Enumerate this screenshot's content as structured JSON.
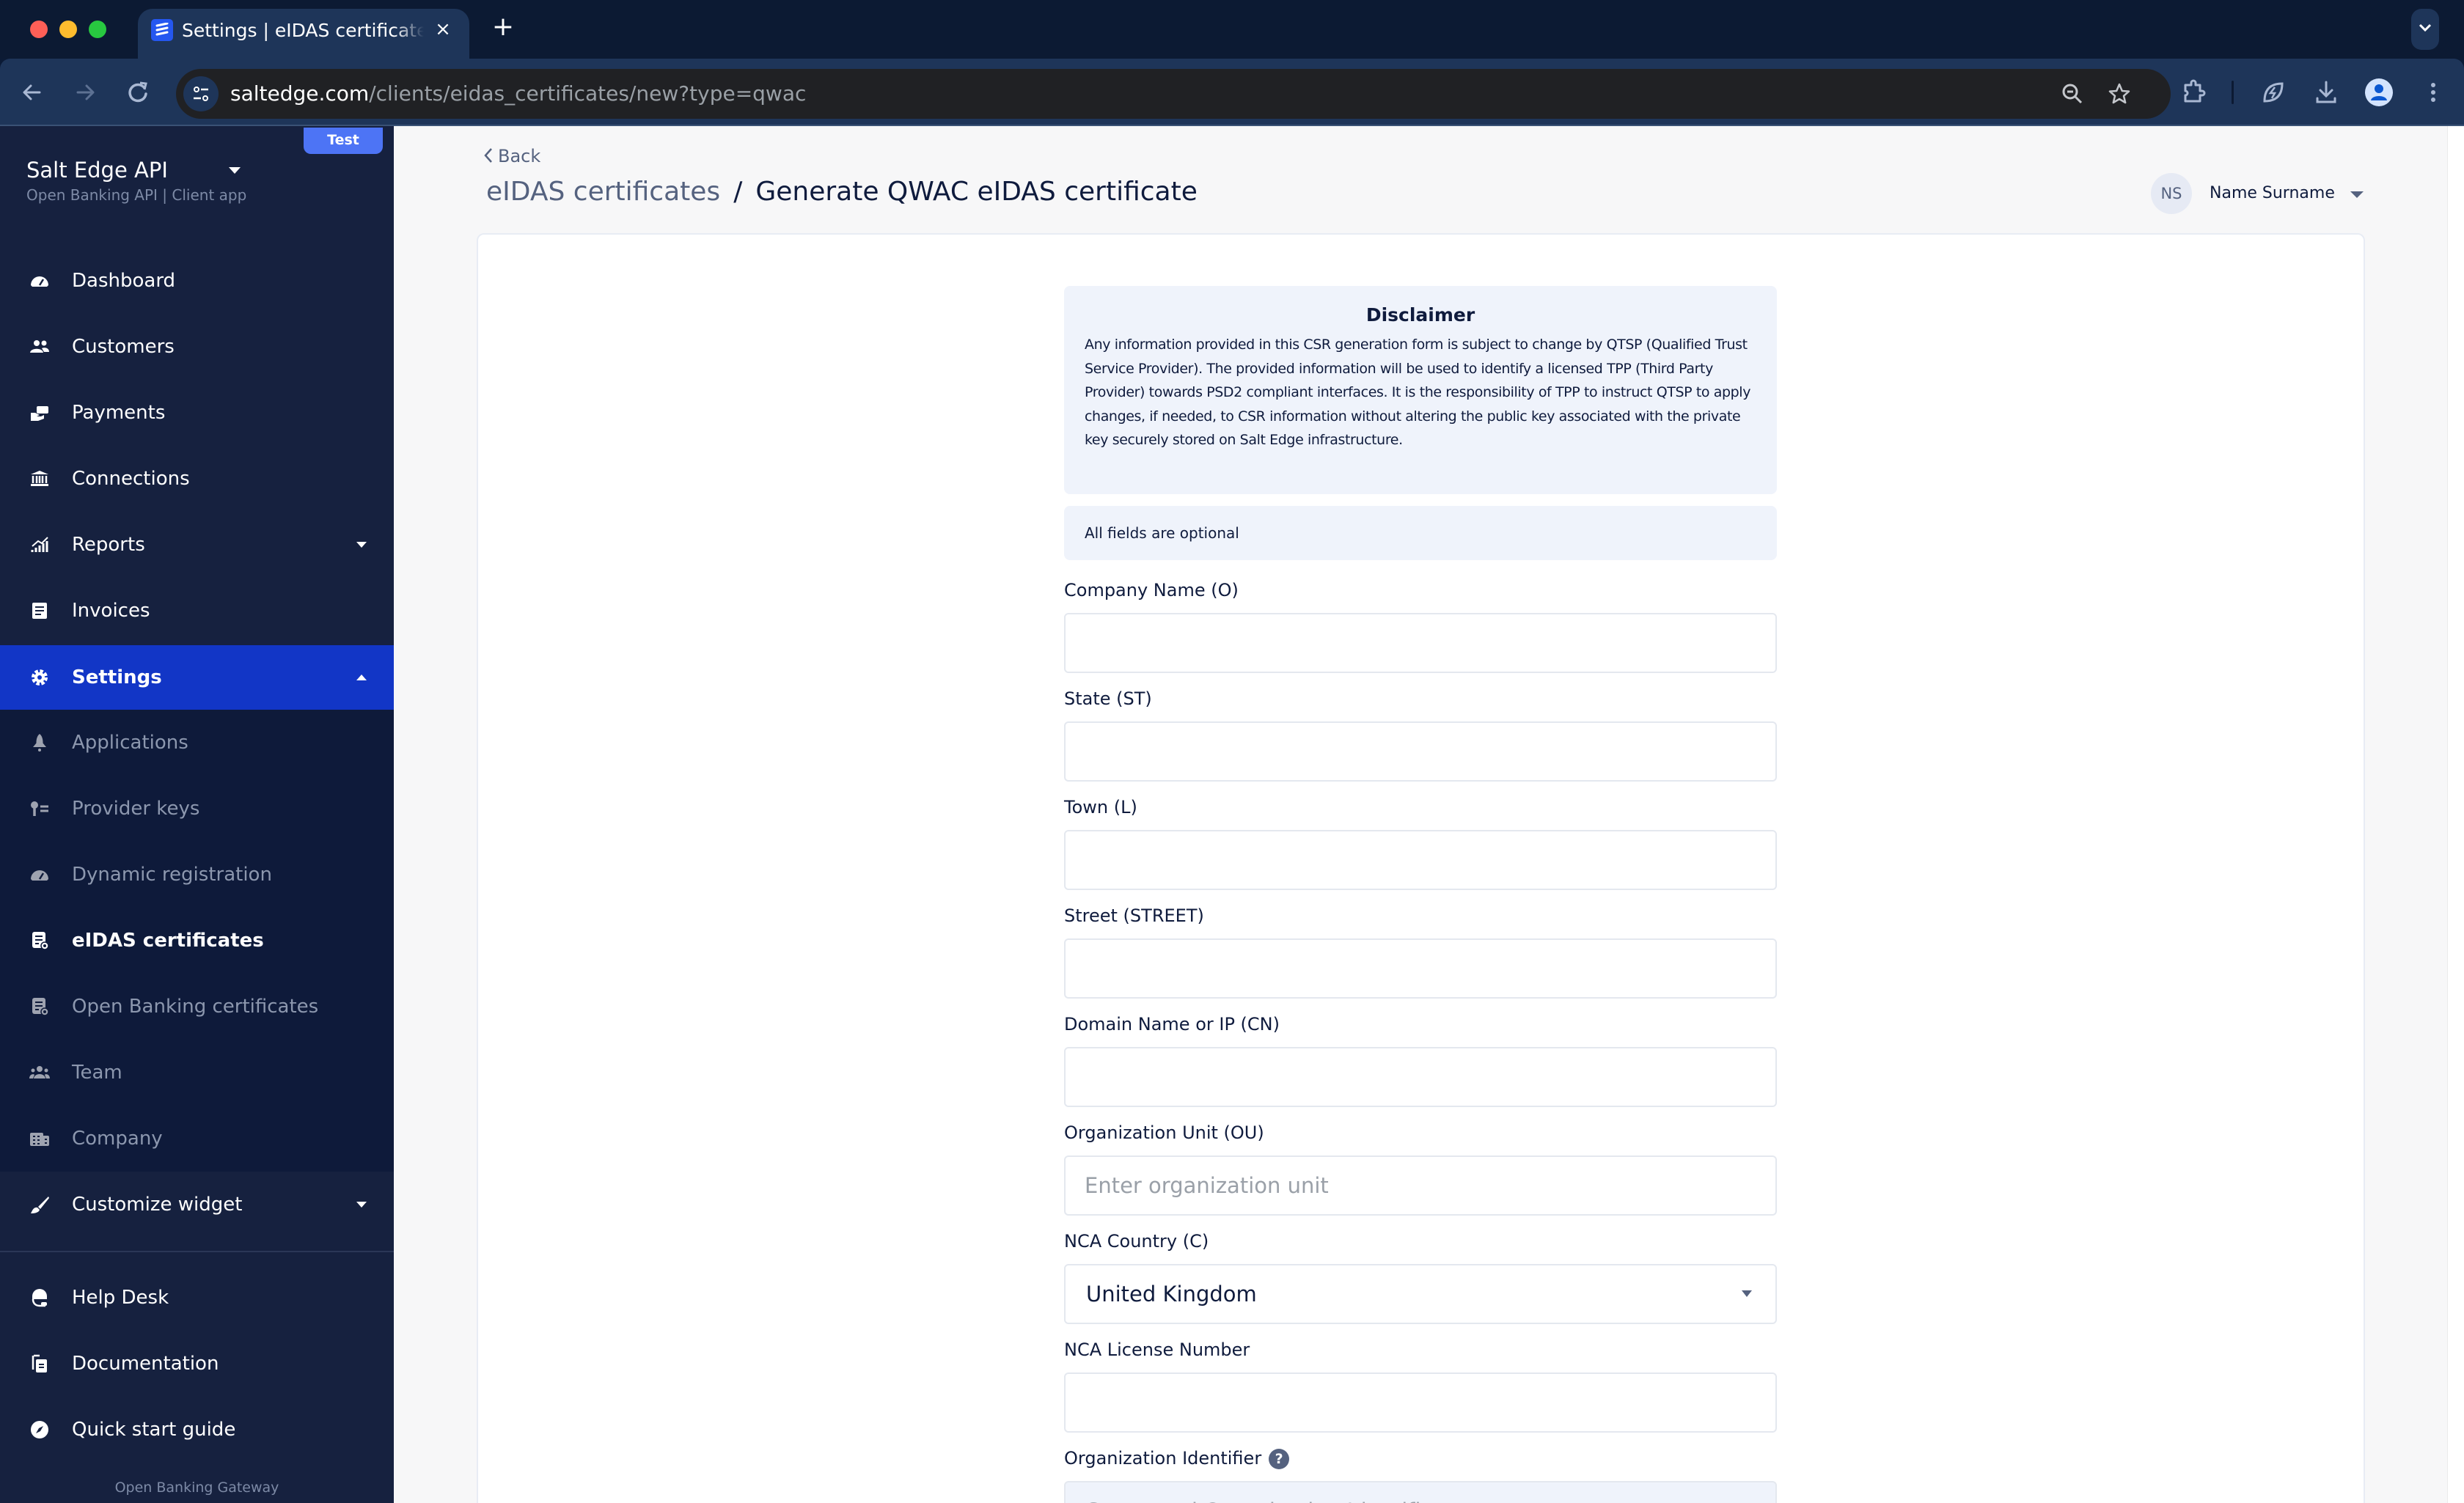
{
  "browser": {
    "tab_title": "Settings | eIDAS certificates",
    "tab_close": "×",
    "new_tab": "+",
    "url_host": "saltedge.com",
    "url_path": "/clients/eidas_certificates/new?type=qwac"
  },
  "sidebar": {
    "env_badge": "Test",
    "app_name": "Salt Edge API",
    "app_subtitle": "Open Banking API | Client app",
    "items": [
      {
        "label": "Dashboard",
        "icon": "dashboard-gauge-icon"
      },
      {
        "label": "Customers",
        "icon": "users-icon"
      },
      {
        "label": "Payments",
        "icon": "payment-hand-icon"
      },
      {
        "label": "Connections",
        "icon": "bank-icon"
      },
      {
        "label": "Reports",
        "icon": "chart-icon",
        "expandable": true
      },
      {
        "label": "Invoices",
        "icon": "invoice-icon"
      },
      {
        "label": "Settings",
        "icon": "gear-icon",
        "expanded": true,
        "active": true
      }
    ],
    "settings_subitems": [
      {
        "label": "Applications",
        "icon": "rocket-icon"
      },
      {
        "label": "Provider keys",
        "icon": "key-list-icon"
      },
      {
        "label": "Dynamic registration",
        "icon": "gauge-icon"
      },
      {
        "label": "eIDAS certificates",
        "icon": "certificate-icon",
        "current": true
      },
      {
        "label": "Open Banking certificates",
        "icon": "certificate-icon"
      },
      {
        "label": "Team",
        "icon": "team-icon"
      },
      {
        "label": "Company",
        "icon": "building-icon"
      }
    ],
    "customize_widget": {
      "label": "Customize widget",
      "icon": "brush-icon"
    },
    "bottom_items": [
      {
        "label": "Help Desk",
        "icon": "headset-icon"
      },
      {
        "label": "Documentation",
        "icon": "documents-icon"
      },
      {
        "label": "Quick start guide",
        "icon": "compass-icon"
      }
    ],
    "footer": "Open Banking Gateway"
  },
  "header": {
    "back_label": "Back",
    "breadcrumb_parent": "eIDAS certificates",
    "breadcrumb_separator": "/",
    "page_title": "Generate QWAC eIDAS certificate",
    "user_initials": "NS",
    "user_name": "Name Surname"
  },
  "form": {
    "disclaimer_title": "Disclaimer",
    "disclaimer_text": "Any information provided in this CSR generation form is subject to change by QTSP (Qualified Trust Service Provider). The provided information will be used to identify a licensed TPP (Third Party Provider) towards PSD2 compliant interfaces. It is the responsibility of TPP to instruct QTSP to apply changes, if needed, to CSR information without altering the public key associated with the private key securely stored on Salt Edge infrastructure.",
    "optional_note": "All fields are optional",
    "fields": [
      {
        "label": "Company Name (O)",
        "value": "",
        "placeholder": ""
      },
      {
        "label": "State (ST)",
        "value": "",
        "placeholder": ""
      },
      {
        "label": "Town (L)",
        "value": "",
        "placeholder": ""
      },
      {
        "label": "Street (STREET)",
        "value": "",
        "placeholder": ""
      },
      {
        "label": "Domain Name or IP (CN)",
        "value": "",
        "placeholder": ""
      },
      {
        "label": "Organization Unit (OU)",
        "value": "",
        "placeholder": "Enter organization unit"
      },
      {
        "label": "NCA Country (C)",
        "value": "United Kingdom",
        "type": "select"
      },
      {
        "label": "NCA License Number",
        "value": "",
        "placeholder": ""
      },
      {
        "label": "Organization Identifier",
        "value": "",
        "placeholder": "Generated Organization Identifier",
        "disabled": true,
        "help": "?"
      }
    ]
  },
  "colors": {
    "sidebar_bg": "#16213f",
    "submenu_bg": "#0e1a3a",
    "active_item": "#1236c6",
    "badge": "#4d74f5",
    "panel_bg": "#eff3fb",
    "text_dark": "#0f1b3d",
    "text_muted": "#55627f"
  }
}
